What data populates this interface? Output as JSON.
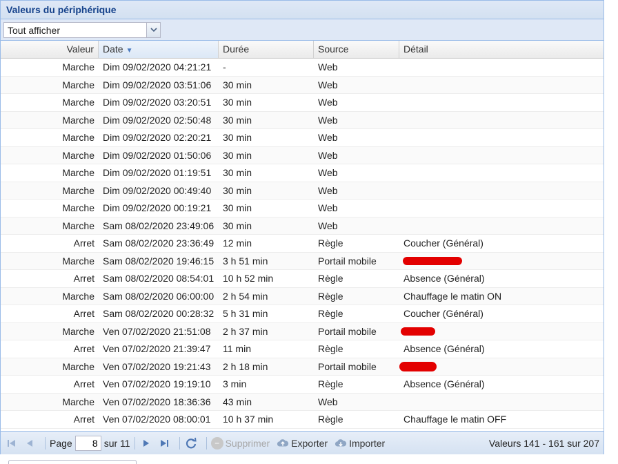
{
  "panel": {
    "title": "Valeurs du périphérique"
  },
  "filter": {
    "value": "Tout afficher"
  },
  "columns": {
    "valeur": "Valeur",
    "date": "Date",
    "duree": "Durée",
    "source": "Source",
    "detail": "Détail"
  },
  "rows": [
    {
      "valeur": "Marche",
      "date": "Dim 09/02/2020 04:21:21",
      "duree": "-",
      "source": "Web",
      "detail": ""
    },
    {
      "valeur": "Marche",
      "date": "Dim 09/02/2020 03:51:06",
      "duree": "30 min",
      "source": "Web",
      "detail": ""
    },
    {
      "valeur": "Marche",
      "date": "Dim 09/02/2020 03:20:51",
      "duree": "30 min",
      "source": "Web",
      "detail": ""
    },
    {
      "valeur": "Marche",
      "date": "Dim 09/02/2020 02:50:48",
      "duree": "30 min",
      "source": "Web",
      "detail": ""
    },
    {
      "valeur": "Marche",
      "date": "Dim 09/02/2020 02:20:21",
      "duree": "30 min",
      "source": "Web",
      "detail": ""
    },
    {
      "valeur": "Marche",
      "date": "Dim 09/02/2020 01:50:06",
      "duree": "30 min",
      "source": "Web",
      "detail": ""
    },
    {
      "valeur": "Marche",
      "date": "Dim 09/02/2020 01:19:51",
      "duree": "30 min",
      "source": "Web",
      "detail": ""
    },
    {
      "valeur": "Marche",
      "date": "Dim 09/02/2020 00:49:40",
      "duree": "30 min",
      "source": "Web",
      "detail": ""
    },
    {
      "valeur": "Marche",
      "date": "Dim 09/02/2020 00:19:21",
      "duree": "30 min",
      "source": "Web",
      "detail": ""
    },
    {
      "valeur": "Marche",
      "date": "Sam 08/02/2020 23:49:06",
      "duree": "30 min",
      "source": "Web",
      "detail": ""
    },
    {
      "valeur": "Arret",
      "date": "Sam 08/02/2020 23:36:49",
      "duree": "12 min",
      "source": "Règle",
      "detail": "Coucher (Général)"
    },
    {
      "valeur": "Marche",
      "date": "Sam 08/02/2020 19:46:15",
      "duree": "3 h 51 min",
      "source": "Portail mobile",
      "detail": ""
    },
    {
      "valeur": "Arret",
      "date": "Sam 08/02/2020 08:54:01",
      "duree": "10 h 52 min",
      "source": "Règle",
      "detail": "Absence (Général)"
    },
    {
      "valeur": "Marche",
      "date": "Sam 08/02/2020 06:00:00",
      "duree": "2 h 54 min",
      "source": "Règle",
      "detail": "Chauffage le matin ON"
    },
    {
      "valeur": "Arret",
      "date": "Sam 08/02/2020 00:28:32",
      "duree": "5 h 31 min",
      "source": "Règle",
      "detail": "Coucher (Général)"
    },
    {
      "valeur": "Marche",
      "date": "Ven 07/02/2020 21:51:08",
      "duree": "2 h 37 min",
      "source": "Portail mobile",
      "detail": ""
    },
    {
      "valeur": "Arret",
      "date": "Ven 07/02/2020 21:39:47",
      "duree": "11 min",
      "source": "Règle",
      "detail": "Absence (Général)"
    },
    {
      "valeur": "Marche",
      "date": "Ven 07/02/2020 19:21:43",
      "duree": "2 h 18 min",
      "source": "Portail mobile",
      "detail": ""
    },
    {
      "valeur": "Arret",
      "date": "Ven 07/02/2020 19:19:10",
      "duree": "3 min",
      "source": "Règle",
      "detail": "Absence (Général)"
    },
    {
      "valeur": "Marche",
      "date": "Ven 07/02/2020 18:36:36",
      "duree": "43 min",
      "source": "Web",
      "detail": ""
    },
    {
      "valeur": "Arret",
      "date": "Ven 07/02/2020 08:00:01",
      "duree": "10 h 37 min",
      "source": "Règle",
      "detail": "Chauffage le matin OFF"
    }
  ],
  "paging": {
    "page_label": "Page",
    "page_value": "8",
    "of_label": "sur 11",
    "delete_label": "Supprimer",
    "export_label": "Exporter",
    "import_label": "Importer",
    "info": "Valeurs 141 - 161 sur 207"
  },
  "icons": {
    "first": "first-page-icon",
    "prev": "prev-page-icon",
    "next": "next-page-icon",
    "last": "last-page-icon",
    "refresh": "refresh-icon",
    "delete": "delete-icon",
    "export": "cloud-upload-icon",
    "import": "cloud-download-icon"
  }
}
